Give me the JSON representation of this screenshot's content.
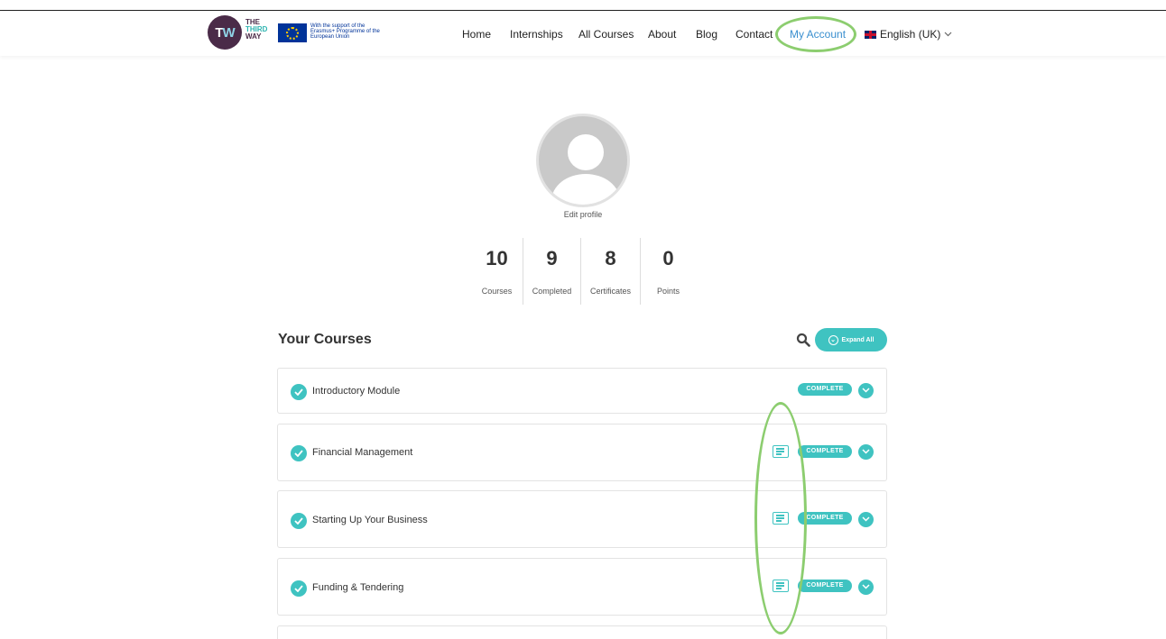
{
  "header": {
    "logo": {
      "monogram_t": "T",
      "monogram_w": "W",
      "line1": "THE",
      "line2": "THIRD",
      "line3": "WAY"
    },
    "eu_notice": "With the support of the Erasmus+ Programme of the European Union",
    "nav": [
      "Home",
      "Internships",
      "All Courses",
      "About",
      "Blog",
      "Contact",
      "My Account"
    ],
    "language": "English (UK)"
  },
  "profile": {
    "edit_label": "Edit profile",
    "stats": [
      {
        "value": "10",
        "label": "Courses"
      },
      {
        "value": "9",
        "label": "Completed"
      },
      {
        "value": "8",
        "label": "Certificates"
      },
      {
        "value": "0",
        "label": "Points"
      }
    ]
  },
  "courses": {
    "title": "Your Courses",
    "expand_label": "Expand All",
    "status_label": "COMPLETE",
    "items": [
      {
        "name": "Introductory Module",
        "certificate": false
      },
      {
        "name": "Financial Management",
        "certificate": true
      },
      {
        "name": "Starting Up Your Business",
        "certificate": true
      },
      {
        "name": "Funding & Tendering",
        "certificate": true
      }
    ]
  },
  "colors": {
    "accent": "#3fc3c1",
    "highlight": "#8ccd6f",
    "link": "#3a8fcf"
  },
  "icons": [
    "search-icon",
    "chevron-down-icon",
    "check-icon",
    "certificate-icon",
    "uk-flag-icon",
    "eu-flag-icon"
  ]
}
